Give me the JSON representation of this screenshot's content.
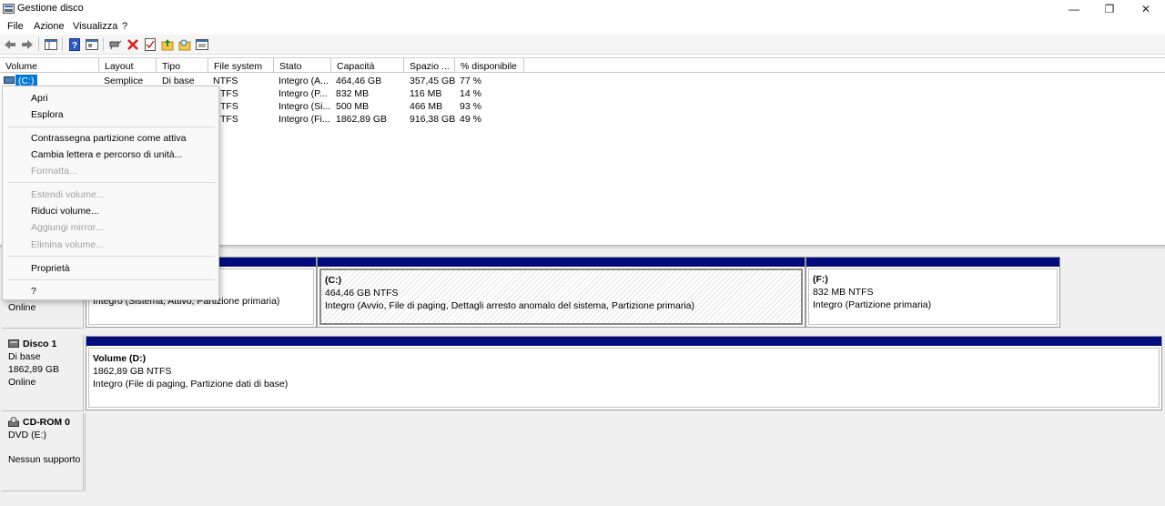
{
  "window": {
    "title": "Gestione disco",
    "controls": {
      "minimize": "—",
      "maximize": "❐",
      "close": "✕"
    }
  },
  "menubar": {
    "items": [
      {
        "label": "File"
      },
      {
        "label": "Azione"
      },
      {
        "label": "Visualizza"
      },
      {
        "label": "?"
      }
    ]
  },
  "toolbar": {
    "icons": [
      "back-icon",
      "forward-icon",
      "console-tree-icon",
      "help-icon",
      "properties-icon",
      "connect-icon",
      "delete-icon",
      "checklist-icon",
      "up-folder-icon",
      "search-folder-icon",
      "export-list-icon"
    ]
  },
  "volume_list": {
    "columns": [
      "Volume",
      "Layout",
      "Tipo",
      "File system",
      "Stato",
      "Capacità",
      "Spazio ...",
      "% disponibile"
    ],
    "rows": [
      {
        "volume": "(C:)",
        "layout": "Semplice",
        "tipo": "Di base",
        "fs": "NTFS",
        "stato": "Integro (A...",
        "capacita": "464,46 GB",
        "spazio": "357,45 GB",
        "perc": "77 %"
      },
      {
        "volume": "",
        "layout": "",
        "tipo": "",
        "fs": "TFS",
        "stato": "Integro (P...",
        "capacita": "832 MB",
        "spazio": "116 MB",
        "perc": "14 %"
      },
      {
        "volume": "",
        "layout": "",
        "tipo": "",
        "fs": "TFS",
        "stato": "Integro (Si...",
        "capacita": "500 MB",
        "spazio": "466 MB",
        "perc": "93 %"
      },
      {
        "volume": "",
        "layout": "",
        "tipo": "",
        "fs": "TFS",
        "stato": "Integro (Fi...",
        "capacita": "1862,89 GB",
        "spazio": "916,38 GB",
        "perc": "49 %"
      }
    ]
  },
  "context_menu": {
    "items": [
      {
        "label": "Apri",
        "enabled": true
      },
      {
        "label": "Esplora",
        "enabled": true
      },
      {
        "label": "Contrassegna partizione come attiva",
        "enabled": true
      },
      {
        "label": "Cambia lettera e percorso di unità...",
        "enabled": true
      },
      {
        "label": "Formatta...",
        "enabled": false
      },
      {
        "label": "Estendi volume...",
        "enabled": false
      },
      {
        "label": "Riduci volume...",
        "enabled": true
      },
      {
        "label": "Aggiungi mirror...",
        "enabled": false
      },
      {
        "label": "Elimina volume...",
        "enabled": false
      },
      {
        "label": "Proprietà",
        "enabled": true
      },
      {
        "label": "?",
        "enabled": true
      }
    ]
  },
  "disks": {
    "disk0": {
      "status": "Online",
      "partitions": [
        {
          "name": "",
          "size": "",
          "status": "Integro (Sistema, Attivo, Partizione primaria)"
        },
        {
          "name": "(C:)",
          "size": "464,46 GB NTFS",
          "status": "Integro (Avvio, File di paging, Dettagli arresto anomalo del sistema, Partizione primaria)"
        },
        {
          "name": "(F:)",
          "size": "832 MB NTFS",
          "status": "Integro (Partizione primaria)"
        }
      ]
    },
    "disk1": {
      "name": "Disco 1",
      "type": "Di base",
      "size": "1862,89 GB",
      "status": "Online",
      "partitions": [
        {
          "name": "Volume  (D:)",
          "size": "1862,89 GB NTFS",
          "status": "Integro (File di paging, Partizione dati di base)"
        }
      ]
    },
    "cdrom0": {
      "name": "CD-ROM 0",
      "type": "DVD (E:)",
      "status": "Nessun supporto"
    }
  },
  "colors": {
    "partition_bar": "#000c7b",
    "selection": "#0078d7"
  }
}
